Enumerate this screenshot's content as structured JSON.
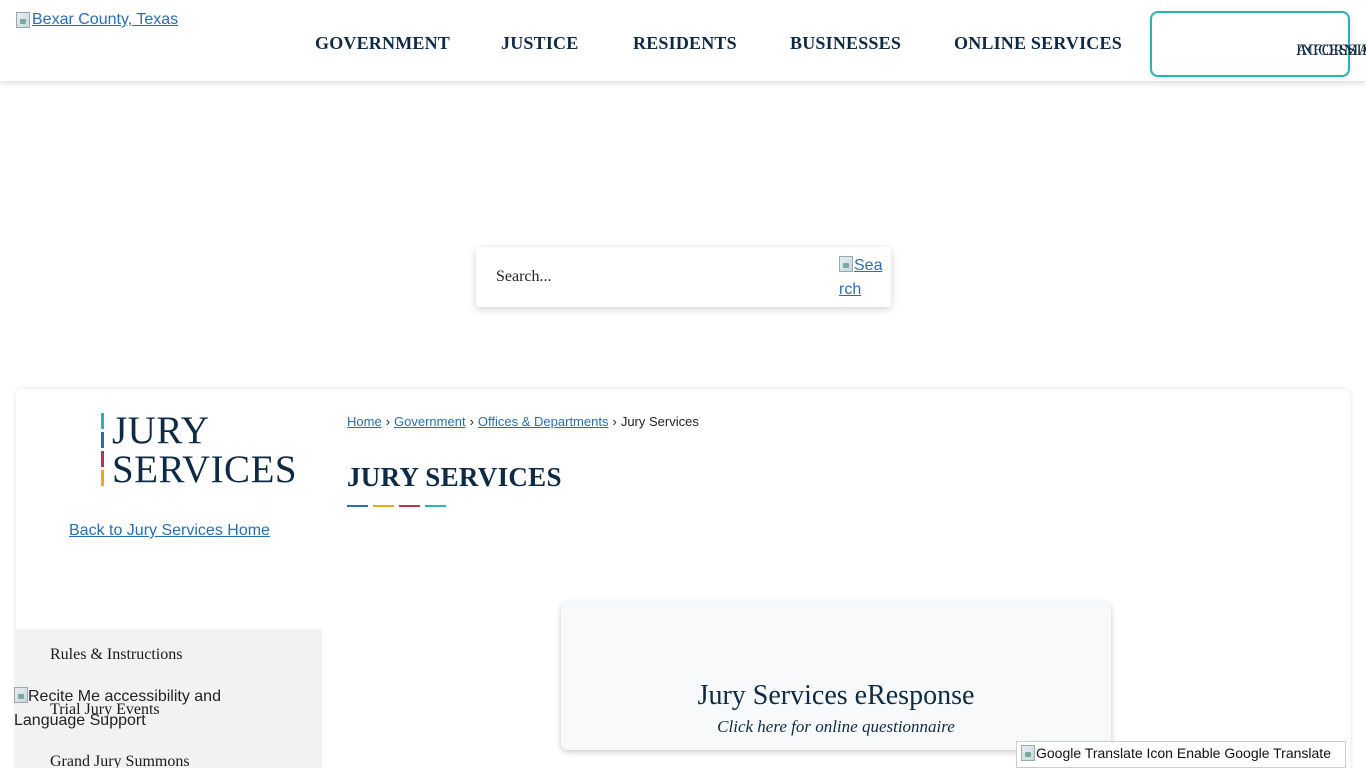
{
  "header": {
    "logo_alt": "Bexar County, Texas",
    "nav": [
      {
        "label": "GOVERNMENT"
      },
      {
        "label": "JUSTICE"
      },
      {
        "label": "RESIDENTS"
      },
      {
        "label": "BUSINESSES"
      },
      {
        "label": "ONLINE SERVICES"
      }
    ],
    "accessibility_line1": "ACCESSIBILITY",
    "accessibility_line2": "INFORMATION"
  },
  "search": {
    "placeholder": "Search...",
    "button_alt": "Search"
  },
  "sidebar": {
    "logo_line1": "JURY",
    "logo_line2": "SERVICES",
    "back_link": "Back to Jury Services Home",
    "items": [
      {
        "label": "Rules & Instructions"
      },
      {
        "label": "Trial Jury Events"
      },
      {
        "label": "Grand Jury Summons"
      }
    ],
    "accent_colors": [
      "#2bb3b1",
      "#2a6db0",
      "#b5344f",
      "#e8a928"
    ]
  },
  "breadcrumb": {
    "items": [
      "Home",
      "Government",
      "Offices & Departments"
    ],
    "current": "Jury Services"
  },
  "main": {
    "title": "JURY SERVICES",
    "title_bar_colors": [
      "#2a6db0",
      "#e8a928",
      "#b5344f",
      "#2bb3b1"
    ],
    "eresponse_title": "Jury Services eResponse",
    "eresponse_sub": "Click here for online questionnaire"
  },
  "widgets": {
    "recite_alt": "Recite Me accessibility and Language Support",
    "translate_alt": "Google Translate Icon",
    "translate_label": "Enable Google Translate"
  }
}
